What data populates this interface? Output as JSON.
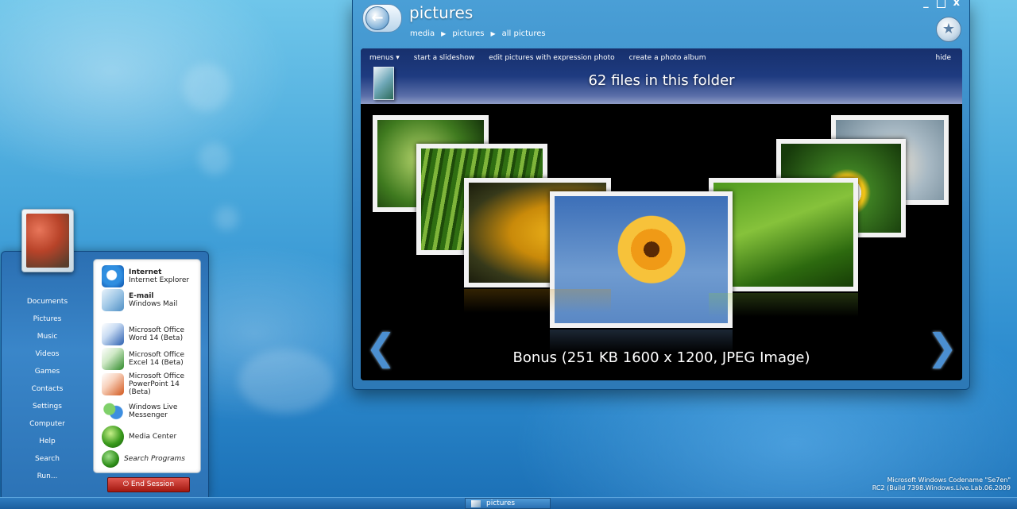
{
  "window": {
    "title": "pictures",
    "breadcrumb": [
      "media",
      "pictures",
      "all pictures"
    ],
    "breadcrumb_separator": "▶",
    "back_icon": "back-arrow-icon",
    "favorite_icon": "star-icon"
  },
  "toolbar": {
    "menus_label": "menus ▾",
    "items": [
      "start a slideshow",
      "edit pictures with expression photo",
      "create a photo album"
    ],
    "hide_label": "hide",
    "file_count_text": "62 files in this folder"
  },
  "viewer": {
    "caption": "Bonus  (251 KB 1600 x 1200, JPEG Image)",
    "prev_arrow": "❮",
    "next_arrow": "❯"
  },
  "start_menu": {
    "left_links": [
      "Documents",
      "Pictures",
      "Music",
      "Videos",
      "Games",
      "Contacts",
      "Settings",
      "Computer",
      "Help",
      "Search",
      "Run..."
    ],
    "programs": [
      {
        "title": "Internet",
        "subtitle": "Internet Explorer",
        "icon": "internet-explorer-icon"
      },
      {
        "title": "E-mail",
        "subtitle": "Windows Mail",
        "icon": "windows-mail-icon"
      },
      {
        "line1": "Microsoft Office",
        "line2": "Word 14 (Beta)",
        "icon": "word-icon"
      },
      {
        "line1": "Microsoft Office",
        "line2": "Excel 14 (Beta)",
        "icon": "excel-icon"
      },
      {
        "line1": "Microsoft Office",
        "line2": "PowerPoint 14 (Beta)",
        "icon": "powerpoint-icon"
      },
      {
        "line1": "Windows Live",
        "line2": "Messenger",
        "icon": "messenger-icon"
      },
      {
        "line1": "Media Center",
        "line2": "",
        "icon": "media-center-icon"
      },
      {
        "line1": "Search Programs",
        "line2": "",
        "icon": "search-programs-icon"
      }
    ],
    "end_session_label": "End Session"
  },
  "taskbar": {
    "active_task": "pictures"
  },
  "watermark": {
    "line1": "Microsoft Windows Codename \"Se7en\"",
    "line2": "RC2 (Build 7398.Windows.Live.Lab.06.2009"
  }
}
